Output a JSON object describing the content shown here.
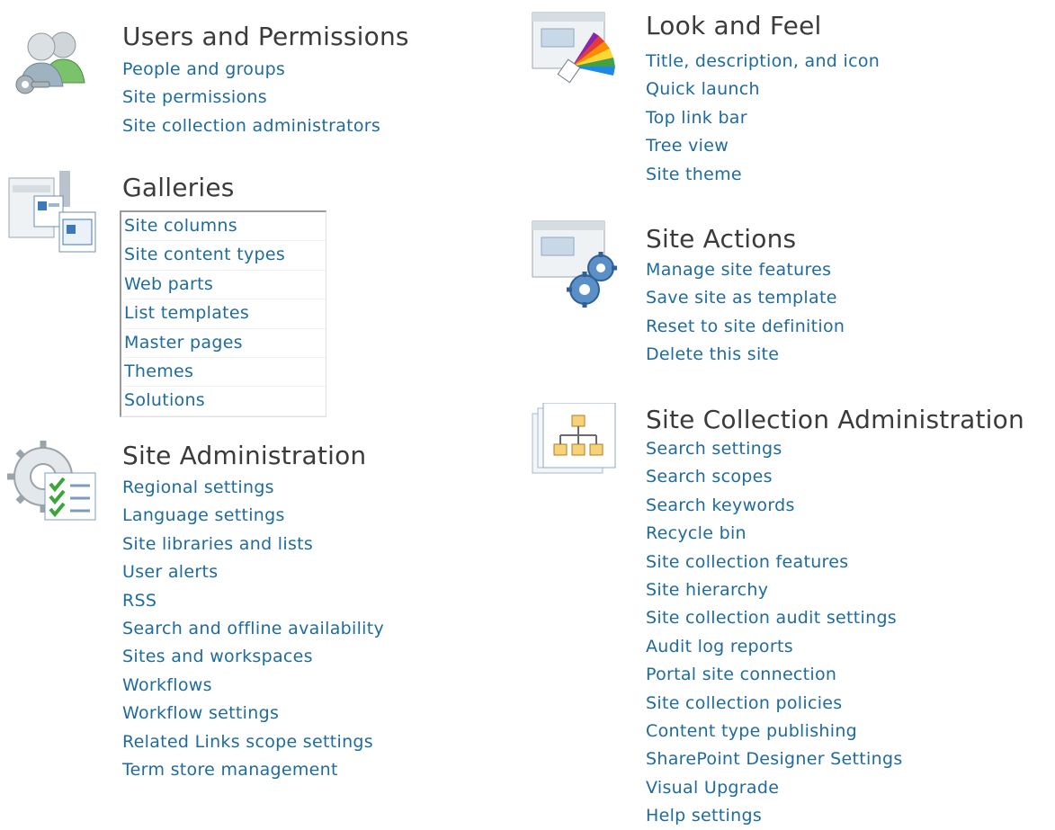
{
  "users_permissions": {
    "icon": "users-key-icon",
    "title": "Users and Permissions",
    "links": [
      "People and groups",
      "Site permissions",
      "Site collection administrators"
    ]
  },
  "galleries": {
    "icon": "galleries-icon",
    "title": "Galleries",
    "links": [
      "Site columns",
      "Site content types",
      "Web parts",
      "List templates",
      "Master pages",
      "Themes",
      "Solutions"
    ]
  },
  "site_administration": {
    "icon": "settings-checklist-icon",
    "title": "Site Administration",
    "links": [
      "Regional settings",
      "Language settings",
      "Site libraries and lists",
      "User alerts",
      "RSS",
      "Search and offline availability",
      "Sites and workspaces",
      "Workflows",
      "Workflow settings",
      "Related Links scope settings",
      "Term store management"
    ]
  },
  "look_and_feel": {
    "icon": "color-palette-icon",
    "title": "Look and Feel",
    "links": [
      "Title, description, and icon",
      "Quick launch",
      "Top link bar",
      "Tree view",
      "Site theme"
    ]
  },
  "site_actions": {
    "icon": "gears-icon",
    "title": "Site Actions",
    "links": [
      "Manage site features",
      "Save site as template",
      "Reset to site definition",
      "Delete this site"
    ]
  },
  "site_collection_administration": {
    "icon": "hierarchy-icon",
    "title": "Site Collection Administration",
    "links": [
      "Search settings",
      "Search scopes",
      "Search keywords",
      "Recycle bin",
      "Site collection features",
      "Site hierarchy",
      "Site collection audit settings",
      "Audit log reports",
      "Portal site connection",
      "Site collection policies",
      "Content type publishing",
      "SharePoint Designer Settings",
      "Visual Upgrade",
      "Help settings"
    ]
  }
}
